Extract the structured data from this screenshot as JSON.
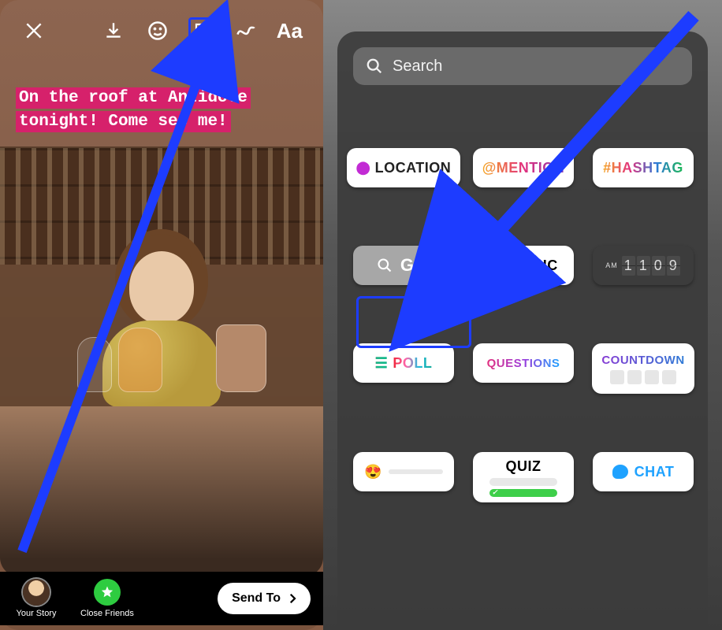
{
  "left": {
    "caption": "On the roof at Antidote tonight! Come see me!",
    "toolbar_text": "Aa",
    "bottom": {
      "your_story": "Your Story",
      "close_friends": "Close Friends",
      "send_to": "Send To"
    }
  },
  "right": {
    "search_placeholder": "Search",
    "stickers": {
      "location": "LOCATION",
      "mention": "@MENTION",
      "hashtag": "#HASHTAG",
      "gif": "GIF",
      "music": "MUSIC",
      "clock": {
        "ampm": "AM",
        "time": "1109"
      },
      "poll": "POLL",
      "questions": "QUESTIONS",
      "countdown": "COUNTDOWN",
      "quiz": "QUIZ",
      "chat": "CHAT"
    }
  }
}
